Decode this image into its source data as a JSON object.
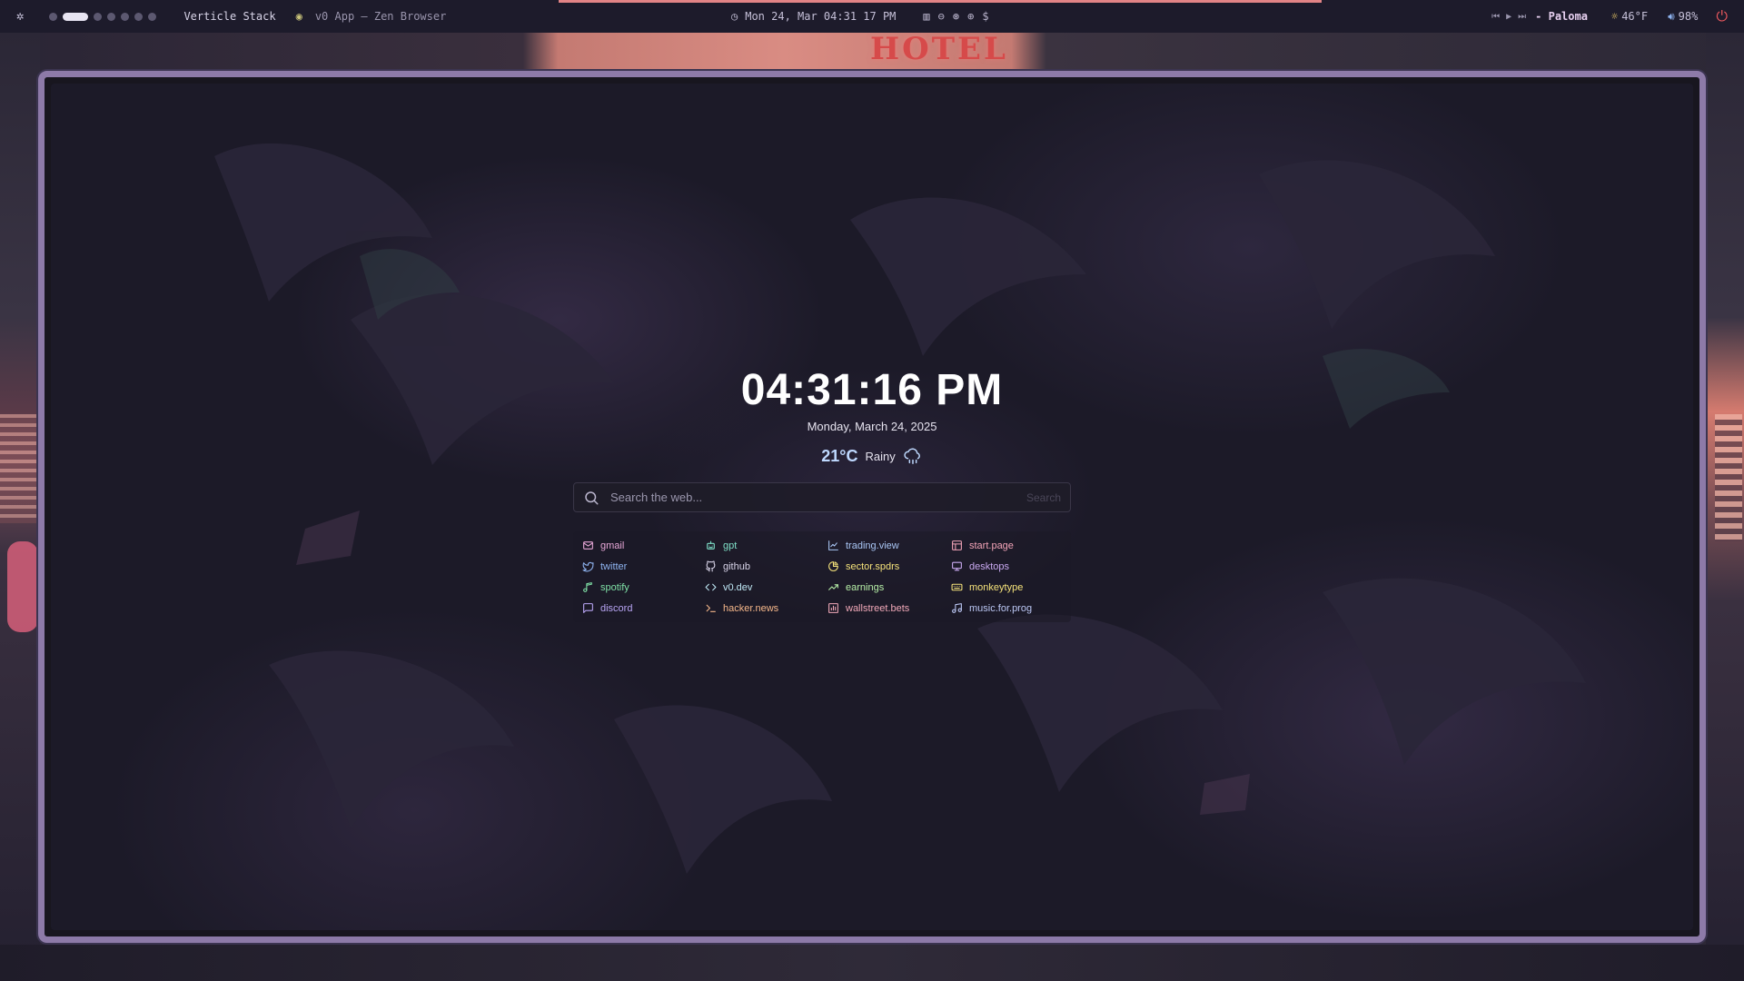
{
  "topbar": {
    "workspace_name": "Verticle Stack",
    "window_title": "v0 App — Zen Browser",
    "clock": "Mon 24, Mar 04:31 17 PM",
    "crypto_symbol": "$",
    "now_playing": "- Paloma",
    "weather": "46°F",
    "volume": "98%"
  },
  "hotel_sign": "HOTEL",
  "startpage": {
    "time": "04:31:16 PM",
    "date": "Monday, March 24, 2025",
    "weather_temp": "21°C",
    "weather_condition": "Rainy",
    "search_placeholder": "Search the web...",
    "search_button": "Search"
  },
  "links": [
    {
      "label": "gmail",
      "icon": "mail-icon",
      "color": "#e8a8d8"
    },
    {
      "label": "gpt",
      "icon": "robot-icon",
      "color": "#7fe0c8"
    },
    {
      "label": "trading.view",
      "icon": "line-chart-icon",
      "color": "#a9c6f5"
    },
    {
      "label": "start.page",
      "icon": "layout-icon",
      "color": "#f3a4b8"
    },
    {
      "label": "twitter",
      "icon": "twitter-icon",
      "color": "#8fb4f0"
    },
    {
      "label": "github",
      "icon": "github-icon",
      "color": "#d8d4e8"
    },
    {
      "label": "sector.spdrs",
      "icon": "pie-chart-icon",
      "color": "#f5e27a"
    },
    {
      "label": "desktops",
      "icon": "monitor-icon",
      "color": "#c9a9f0"
    },
    {
      "label": "spotify",
      "icon": "music-note-icon",
      "color": "#7fe0a6"
    },
    {
      "label": "v0.dev",
      "icon": "code-icon",
      "color": "#bfe8f5"
    },
    {
      "label": "earnings",
      "icon": "trending-up-icon",
      "color": "#b7f0a8"
    },
    {
      "label": "monkeytype",
      "icon": "keyboard-icon",
      "color": "#f5e27a"
    },
    {
      "label": "discord",
      "icon": "message-icon",
      "color": "#b9a6f5"
    },
    {
      "label": "hacker.news",
      "icon": "terminal-icon",
      "color": "#f5b78a"
    },
    {
      "label": "wallstreet.bets",
      "icon": "bar-chart-icon",
      "color": "#f0a8b8"
    },
    {
      "label": "music.for.prog",
      "icon": "music-icon",
      "color": "#bcc8f5"
    }
  ]
}
